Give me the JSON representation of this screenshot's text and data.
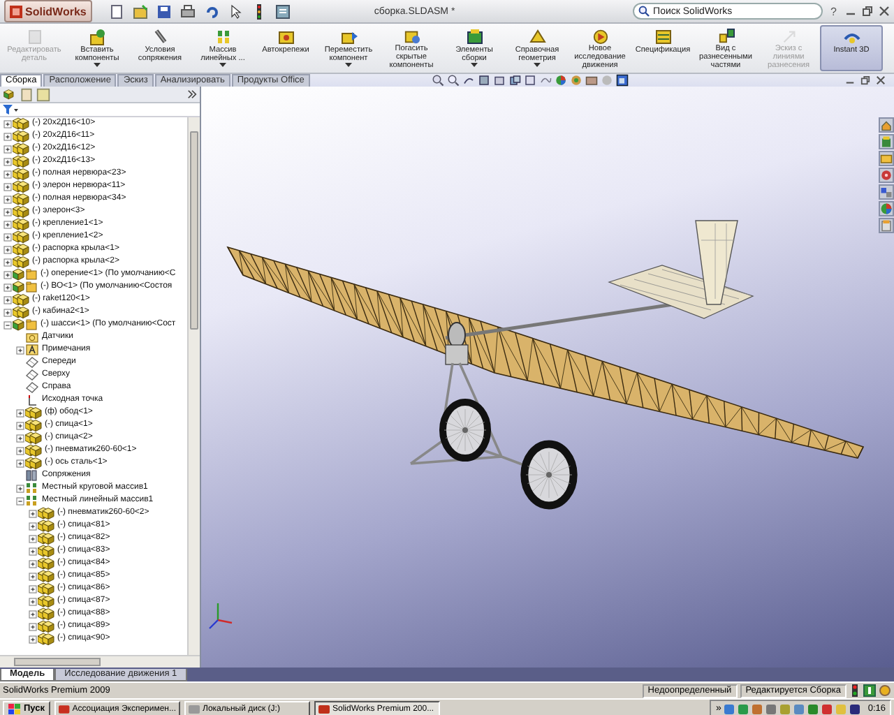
{
  "window": {
    "app_name": "SolidWorks",
    "title": "сборка.SLDASM *",
    "search": {
      "placeholder": "Поиск SolidWorks"
    },
    "help": "?"
  },
  "ribbon": [
    {
      "label": "Редактировать деталь",
      "disabled": true,
      "dropdown": false,
      "selected": false
    },
    {
      "label": "Вставить компоненты",
      "disabled": false,
      "dropdown": true,
      "selected": false
    },
    {
      "label": "Условия сопряжения",
      "disabled": false,
      "dropdown": false,
      "selected": false
    },
    {
      "label": "Массив линейных ...",
      "disabled": false,
      "dropdown": true,
      "selected": false
    },
    {
      "label": "Автокрепежи",
      "disabled": false,
      "dropdown": false,
      "selected": false
    },
    {
      "label": "Переместить компонент",
      "disabled": false,
      "dropdown": true,
      "selected": false
    },
    {
      "label": "Погасить скрытые компоненты",
      "disabled": false,
      "dropdown": false,
      "selected": false
    },
    {
      "label": "Элементы сборки",
      "disabled": false,
      "dropdown": true,
      "selected": false
    },
    {
      "label": "Справочная геометрия",
      "disabled": false,
      "dropdown": true,
      "selected": false
    },
    {
      "label": "Новое исследование движения",
      "disabled": false,
      "dropdown": false,
      "selected": false
    },
    {
      "label": "Спецификация",
      "disabled": false,
      "dropdown": false,
      "selected": false
    },
    {
      "label": "Вид с разнесенными частями",
      "disabled": false,
      "dropdown": false,
      "selected": false
    },
    {
      "label": "Эскиз с линиями разнесения",
      "disabled": true,
      "dropdown": false,
      "selected": false
    },
    {
      "label": "Instant 3D",
      "disabled": false,
      "dropdown": false,
      "selected": true
    }
  ],
  "command_tabs": [
    {
      "label": "Сборка",
      "selected": true
    },
    {
      "label": "Расположение",
      "selected": false
    },
    {
      "label": "Эскиз",
      "selected": false
    },
    {
      "label": "Анализировать",
      "selected": false
    },
    {
      "label": "Продукты Office",
      "selected": false
    }
  ],
  "feature_tree": {
    "items": [
      {
        "label": "(-) 20x2Д16<10>",
        "kind": "part",
        "expanded": false
      },
      {
        "label": "(-) 20x2Д16<11>",
        "kind": "part",
        "expanded": false
      },
      {
        "label": "(-) 20x2Д16<12>",
        "kind": "part",
        "expanded": false
      },
      {
        "label": "(-) 20x2Д16<13>",
        "kind": "part",
        "expanded": false
      },
      {
        "label": "(-) полная нервюра<23>",
        "kind": "part",
        "expanded": false
      },
      {
        "label": "(-) элерон нервюра<11>",
        "kind": "part",
        "expanded": false
      },
      {
        "label": "(-) полная нервюра<34>",
        "kind": "part",
        "expanded": false
      },
      {
        "label": "(-) элерон<3>",
        "kind": "part",
        "expanded": false
      },
      {
        "label": "(-) крепление1<1>",
        "kind": "part",
        "expanded": false
      },
      {
        "label": "(-) крепление1<2>",
        "kind": "part",
        "expanded": false
      },
      {
        "label": "(-) распорка крыла<1>",
        "kind": "part",
        "expanded": false
      },
      {
        "label": "(-) распорка крыла<2>",
        "kind": "part",
        "expanded": false
      },
      {
        "label": "(-) оперение<1> (По умолчанию<С",
        "kind": "assembly",
        "expanded": false
      },
      {
        "label": "(-) ВО<1> (По умолчанию<Состоя",
        "kind": "assembly",
        "expanded": false
      },
      {
        "label": "(-) raket120<1>",
        "kind": "part",
        "expanded": false
      },
      {
        "label": "(-) кабина2<1>",
        "kind": "part",
        "expanded": false
      },
      {
        "label": "(-) шасси<1> (По умолчанию<Сост",
        "kind": "assembly",
        "expanded": true,
        "children": [
          {
            "label": "Датчики",
            "kind": "folder"
          },
          {
            "label": "Примечания",
            "kind": "annotations",
            "expanded": false
          },
          {
            "label": "Спереди",
            "kind": "plane"
          },
          {
            "label": "Сверху",
            "kind": "plane"
          },
          {
            "label": "Справа",
            "kind": "plane"
          },
          {
            "label": "Исходная точка",
            "kind": "origin"
          },
          {
            "label": "(ф) обод<1>",
            "kind": "part",
            "expanded": false
          },
          {
            "label": "(-) спица<1>",
            "kind": "part",
            "expanded": false
          },
          {
            "label": "(-) спица<2>",
            "kind": "part",
            "expanded": false
          },
          {
            "label": "(-) пневматик260-60<1>",
            "kind": "part",
            "expanded": false
          },
          {
            "label": "(-) ось сталь<1>",
            "kind": "part",
            "expanded": false
          },
          {
            "label": "Сопряжения",
            "kind": "mates"
          },
          {
            "label": "Местный круговой массив1",
            "kind": "pattern",
            "expanded": false
          },
          {
            "label": "Местный линейный массив1",
            "kind": "pattern",
            "expanded": true,
            "children": [
              {
                "label": "(-) пневматик260-60<2>",
                "kind": "part",
                "expanded": false
              },
              {
                "label": "(-) спица<81>",
                "kind": "part",
                "expanded": false
              },
              {
                "label": "(-) спица<82>",
                "kind": "part",
                "expanded": false
              },
              {
                "label": "(-) спица<83>",
                "kind": "part",
                "expanded": false
              },
              {
                "label": "(-) спица<84>",
                "kind": "part",
                "expanded": false
              },
              {
                "label": "(-) спица<85>",
                "kind": "part",
                "expanded": false
              },
              {
                "label": "(-) спица<86>",
                "kind": "part",
                "expanded": false
              },
              {
                "label": "(-) спица<87>",
                "kind": "part",
                "expanded": false
              },
              {
                "label": "(-) спица<88>",
                "kind": "part",
                "expanded": false
              },
              {
                "label": "(-) спица<89>",
                "kind": "part",
                "expanded": false
              },
              {
                "label": "(-) спица<90>",
                "kind": "part",
                "expanded": false
              }
            ]
          }
        ]
      }
    ]
  },
  "bottom_tabs": [
    {
      "label": "Модель",
      "selected": true
    },
    {
      "label": "Исследование движения 1",
      "selected": false
    }
  ],
  "status_bar": {
    "product": "SolidWorks Premium 2009",
    "fields": [
      "Недоопределенный",
      "Редактируется Сборка"
    ]
  },
  "taskbar": {
    "start": "Пуск",
    "tasks": [
      {
        "label": "Ассоциация Эксперимен...",
        "selected": false
      },
      {
        "label": "Локальный диск (J:)",
        "selected": false
      },
      {
        "label": "SolidWorks Premium 200...",
        "selected": true
      }
    ],
    "tray_more": "»",
    "clock": "0:16"
  }
}
